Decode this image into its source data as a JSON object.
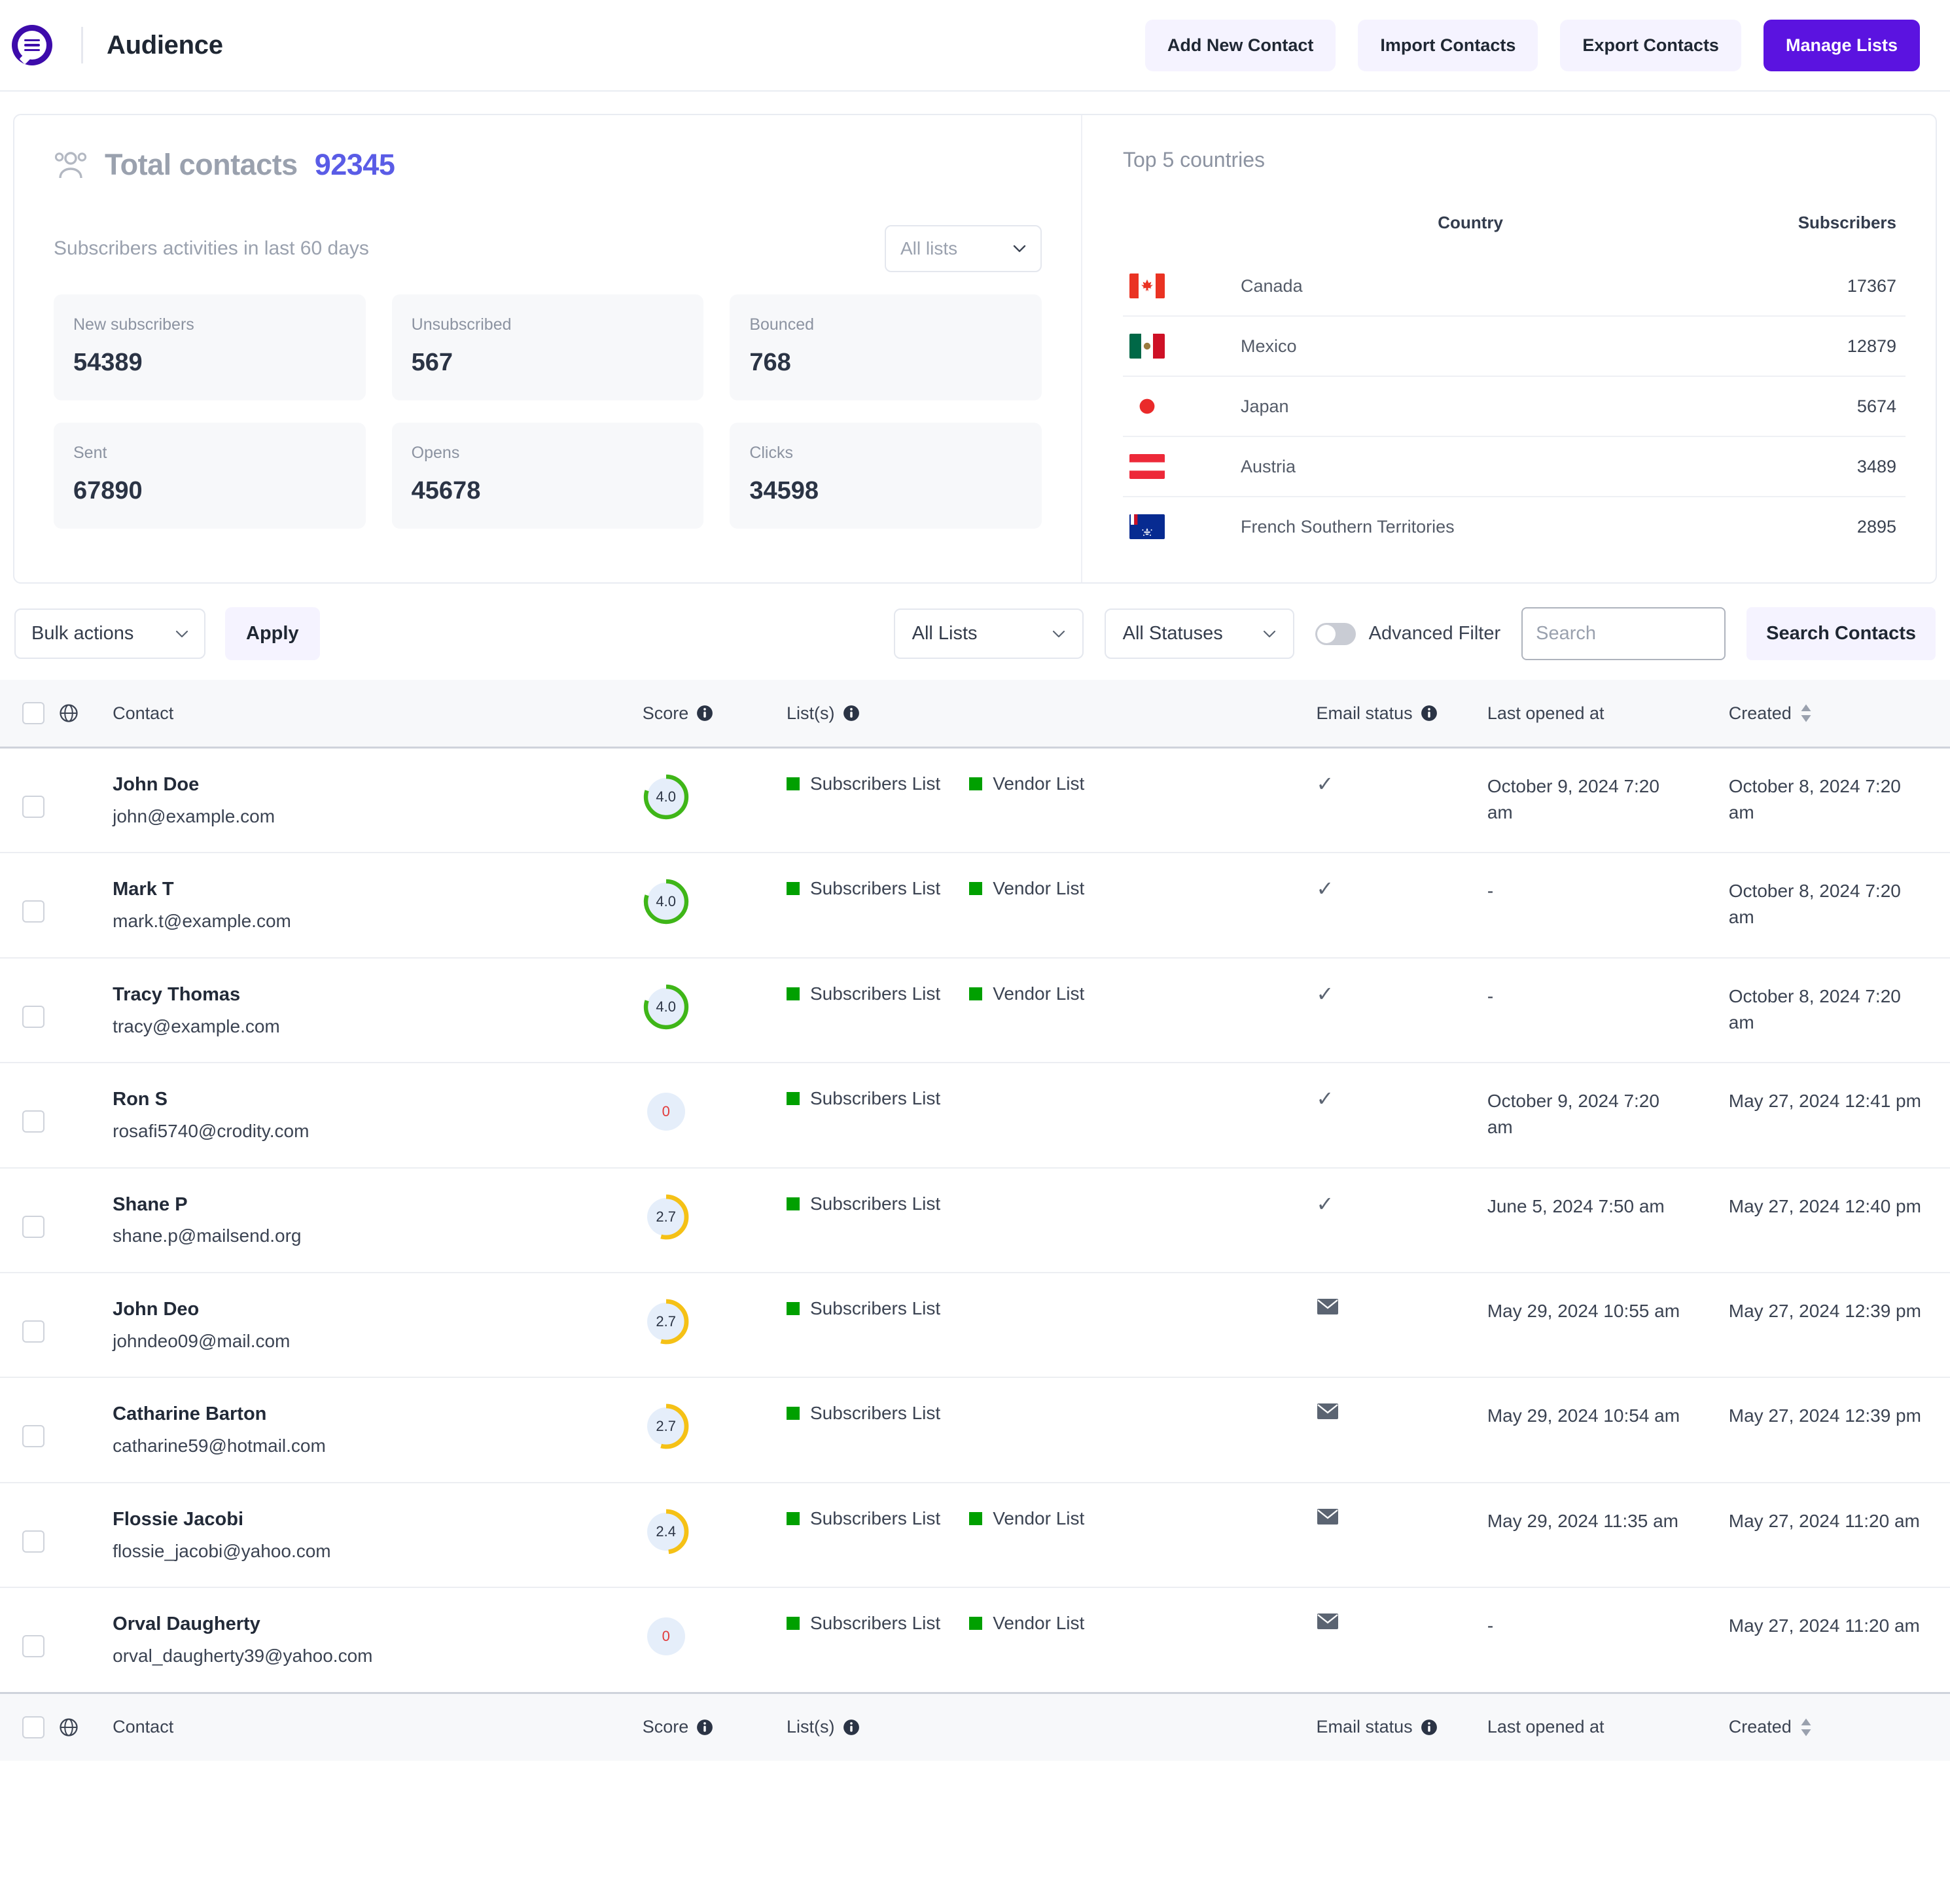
{
  "header": {
    "logo_icon": "chat-list-logo-icon",
    "title": "Audience",
    "buttons": [
      {
        "label": "Add New Contact",
        "name": "add-new-contact-button",
        "primary": false
      },
      {
        "label": "Import Contacts",
        "name": "import-contacts-button",
        "primary": false
      },
      {
        "label": "Export Contacts",
        "name": "export-contacts-button",
        "primary": false
      },
      {
        "label": "Manage Lists",
        "name": "manage-lists-button",
        "primary": true
      }
    ]
  },
  "summary": {
    "total_label": "Total contacts",
    "total_value": "92345",
    "activity_title": "Subscribers activities in last 60 days",
    "list_filter_value": "All lists",
    "stats": [
      {
        "label": "New subscribers",
        "value": "54389"
      },
      {
        "label": "Unsubscribed",
        "value": "567"
      },
      {
        "label": "Bounced",
        "value": "768"
      },
      {
        "label": "Sent",
        "value": "67890"
      },
      {
        "label": "Opens",
        "value": "45678"
      },
      {
        "label": "Clicks",
        "value": "34598"
      }
    ]
  },
  "countries": {
    "title": "Top 5 countries",
    "col_country": "Country",
    "col_subscribers": "Subscribers",
    "rows": [
      {
        "flag": "canada-flag-icon",
        "name": "Canada",
        "subscribers": "17367"
      },
      {
        "flag": "mexico-flag-icon",
        "name": "Mexico",
        "subscribers": "12879"
      },
      {
        "flag": "japan-flag-icon",
        "name": "Japan",
        "subscribers": "5674"
      },
      {
        "flag": "austria-flag-icon",
        "name": "Austria",
        "subscribers": "3489"
      },
      {
        "flag": "french-southern-territories-flag-icon",
        "name": "French Southern Territories",
        "subscribers": "2895"
      }
    ]
  },
  "toolbar": {
    "bulk_actions_value": "Bulk actions",
    "apply_label": "Apply",
    "all_lists_value": "All Lists",
    "all_statuses_value": "All Statuses",
    "advanced_filter_label": "Advanced Filter",
    "advanced_filter_on": false,
    "search_placeholder": "Search",
    "search_value": "",
    "search_button_label": "Search Contacts"
  },
  "table": {
    "columns": {
      "contact": "Contact",
      "score": "Score",
      "lists": "List(s)",
      "email_status": "Email status",
      "last_opened": "Last opened at",
      "created": "Created"
    },
    "rows": [
      {
        "name": "John Doe",
        "email": "john@example.com",
        "score": "4.0",
        "score_pct": 80,
        "score_color": "#3fb618",
        "lists": [
          "Subscribers List",
          "Vendor List"
        ],
        "status": "check",
        "last_opened": "October 9, 2024 7:20 am",
        "created": "October 8, 2024 7:20 am"
      },
      {
        "name": "Mark T",
        "email": "mark.t@example.com",
        "score": "4.0",
        "score_pct": 80,
        "score_color": "#3fb618",
        "lists": [
          "Subscribers List",
          "Vendor List"
        ],
        "status": "check",
        "last_opened": "-",
        "created": "October 8, 2024 7:20 am"
      },
      {
        "name": "Tracy Thomas",
        "email": "tracy@example.com",
        "score": "4.0",
        "score_pct": 80,
        "score_color": "#3fb618",
        "lists": [
          "Subscribers List",
          "Vendor List"
        ],
        "status": "check",
        "last_opened": "-",
        "created": "October 8, 2024 7:20 am"
      },
      {
        "name": "Ron S",
        "email": "rosafi5740@crodity.com",
        "score": "0",
        "score_pct": 0,
        "score_color": "#e23b3b",
        "lists": [
          "Subscribers List"
        ],
        "status": "check",
        "last_opened": "October 9, 2024 7:20 am",
        "created": "May 27, 2024 12:41 pm"
      },
      {
        "name": "Shane P",
        "email": "shane.p@mailsend.org",
        "score": "2.7",
        "score_pct": 54,
        "score_color": "#f5c116",
        "lists": [
          "Subscribers List"
        ],
        "status": "check",
        "last_opened": "June 5, 2024 7:50 am",
        "created": "May 27, 2024 12:40 pm"
      },
      {
        "name": "John Deo",
        "email": "johndeo09@mail.com",
        "score": "2.7",
        "score_pct": 54,
        "score_color": "#f5c116",
        "lists": [
          "Subscribers List"
        ],
        "status": "envelope",
        "last_opened": "May 29, 2024 10:55 am",
        "created": "May 27, 2024 12:39 pm"
      },
      {
        "name": "Catharine Barton",
        "email": "catharine59@hotmail.com",
        "score": "2.7",
        "score_pct": 54,
        "score_color": "#f5c116",
        "lists": [
          "Subscribers List"
        ],
        "status": "envelope",
        "last_opened": "May 29, 2024 10:54 am",
        "created": "May 27, 2024 12:39 pm"
      },
      {
        "name": "Flossie Jacobi",
        "email": "flossie_jacobi@yahoo.com",
        "score": "2.4",
        "score_pct": 48,
        "score_color": "#f5c116",
        "lists": [
          "Subscribers List",
          "Vendor List"
        ],
        "status": "envelope",
        "last_opened": "May 29, 2024 11:35 am",
        "created": "May 27, 2024 11:20 am"
      },
      {
        "name": "Orval Daugherty",
        "email": "orval_daugherty39@yahoo.com",
        "score": "0",
        "score_pct": 0,
        "score_color": "#e23b3b",
        "lists": [
          "Subscribers List",
          "Vendor List"
        ],
        "status": "envelope",
        "last_opened": "-",
        "created": "May 27, 2024 11:20 am"
      }
    ]
  },
  "colors": {
    "brand_purple": "#5b13e0",
    "logo_purple": "#3d0bab",
    "accent_blue": "#5a5ce6",
    "score_green": "#3fb618",
    "score_yellow": "#f5c116",
    "score_red": "#e23b3b",
    "list_green": "#00a000"
  }
}
